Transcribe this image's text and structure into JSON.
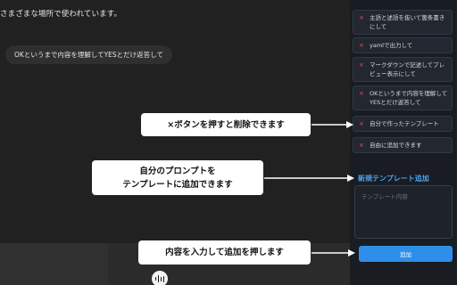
{
  "chat": {
    "message_text": "さまざまな場所で使われています。",
    "user_message": "OKというまで内容を理解してYESとだけ返答して"
  },
  "sidebar": {
    "items": [
      {
        "label": "主語と述語を抜いて箇条書きにして"
      },
      {
        "label": "yamlで出力して"
      },
      {
        "label": "マークダウンで記述してプレビュー表示にして"
      },
      {
        "label": "OKというまで内容を理解してYESとだけ返答して"
      },
      {
        "label": "自分で作ったテンプレート",
        "delete_icon": "×"
      },
      {
        "label": "自由に追加できます",
        "delete_icon": "×"
      }
    ],
    "add_title": "新規テンプレート追加",
    "textarea_placeholder": "テンプレート内容",
    "add_button": "追加"
  },
  "callouts": {
    "delete": "×ボタンを押すと削除できます",
    "prompt_line1": "自分のプロンプトを",
    "prompt_line2": "テンプレートに追加できます",
    "input": "内容を入力して追加を押します"
  },
  "icons": {
    "voice": "voice-wave-icon",
    "delete": "close-icon"
  },
  "colors": {
    "background": "#212121",
    "sidebar": "#191c22",
    "accent": "#2f8fe8",
    "title": "#4aa3f0",
    "delete": "#e05555"
  }
}
